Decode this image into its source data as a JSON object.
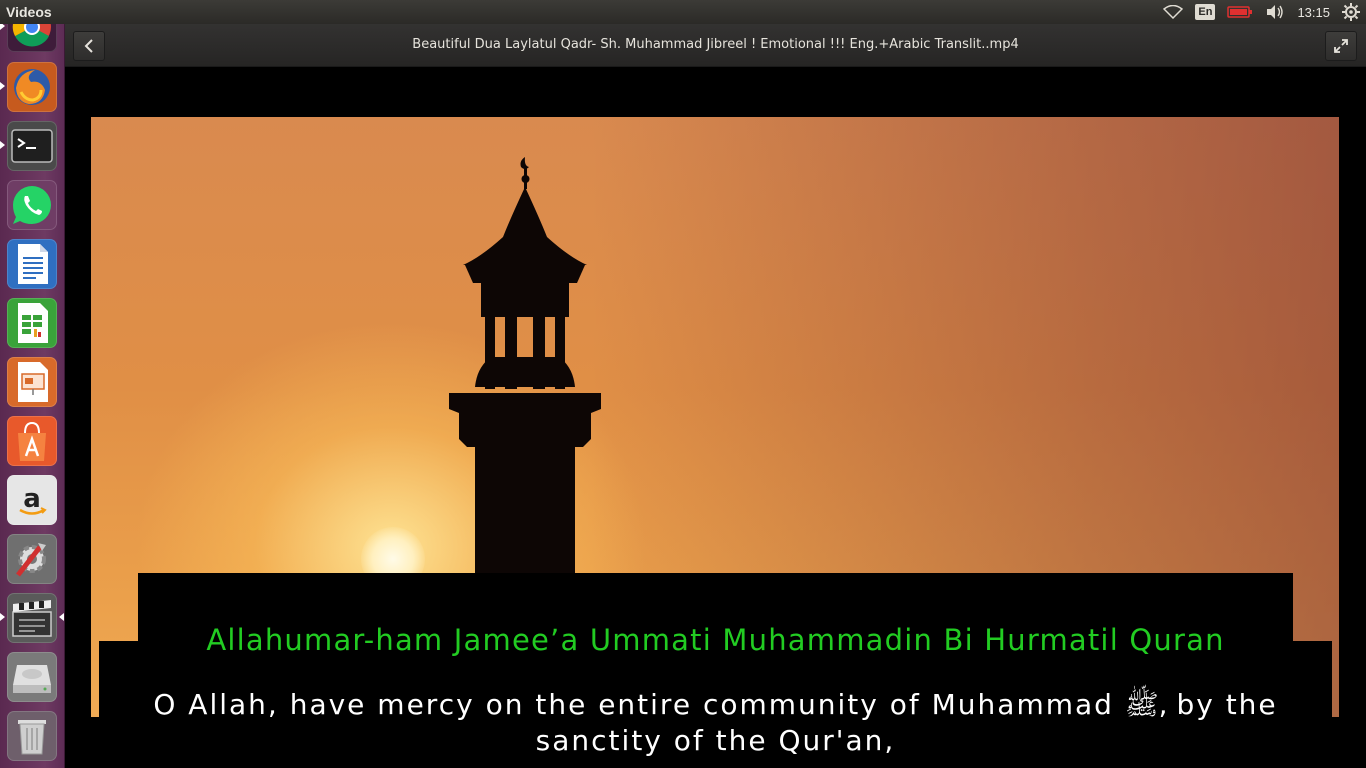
{
  "top_panel": {
    "app_name": "Videos",
    "language": "En",
    "clock": "13:15",
    "icons": [
      "wifi-icon",
      "keyboard-language-icon",
      "battery-icon",
      "volume-icon",
      "settings-gear-icon"
    ],
    "battery_color": "#e03030"
  },
  "launcher": {
    "items": [
      {
        "name": "chrome-icon",
        "running": true
      },
      {
        "name": "firefox-icon",
        "running": true
      },
      {
        "name": "terminal-icon",
        "running": true
      },
      {
        "name": "whatsapp-icon",
        "running": false
      },
      {
        "name": "libreoffice-writer-icon",
        "running": false
      },
      {
        "name": "libreoffice-calc-icon",
        "running": false
      },
      {
        "name": "libreoffice-impress-icon",
        "running": false
      },
      {
        "name": "ubuntu-software-icon",
        "running": false
      },
      {
        "name": "amazon-icon",
        "running": false
      },
      {
        "name": "system-settings-icon",
        "running": false
      },
      {
        "name": "videos-app-icon",
        "running": true,
        "active": true
      },
      {
        "name": "drive-icon",
        "running": false
      },
      {
        "name": "trash-icon",
        "running": false
      }
    ]
  },
  "header": {
    "title": "Beautiful Dua Laylatul Qadr- Sh. Muhammad Jibreel ! Emotional !!! Eng.+Arabic Translit..mp4"
  },
  "video": {
    "subtitle_transliteration": "Allahumar-ham Jamee’a Ummati Muhammadin Bi Hurmatil Quran",
    "subtitle_translation": "O Allah, have mercy on the entire community of Muhammad ﷺ, by the sanctity of the Qur'an,",
    "transliteration_color": "#22cc22",
    "translation_color": "#ffffff"
  }
}
